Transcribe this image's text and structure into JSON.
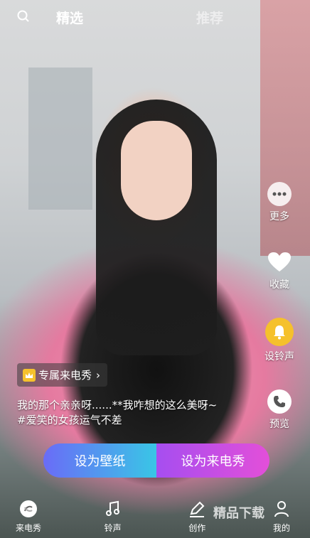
{
  "top": {
    "tabs": [
      "精选",
      "推荐"
    ],
    "active_index": 0
  },
  "side_actions": [
    {
      "label": "更多",
      "icon": "more-icon"
    },
    {
      "label": "收藏",
      "icon": "heart-icon"
    },
    {
      "label": "设铃声",
      "icon": "bell-icon",
      "accent": "#f5c12c"
    },
    {
      "label": "预览",
      "icon": "phone-icon"
    }
  ],
  "badge": {
    "label": "专属来电秀"
  },
  "description": {
    "line1": "我的那个亲亲呀......**我咋想的这么美呀~",
    "line2": "#爱笑的女孩运气不差"
  },
  "cta": {
    "wallpaper": "设为壁纸",
    "callshow": "设为来电秀"
  },
  "bottom_nav": [
    "来电秀",
    "铃声",
    "创作",
    "我的"
  ],
  "watermark": "精品下载"
}
